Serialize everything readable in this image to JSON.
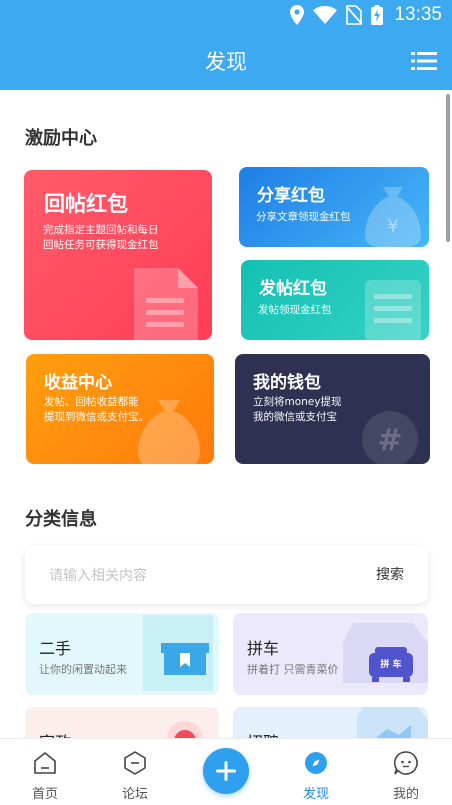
{
  "status_bar": {
    "time": "13:35",
    "icons": [
      "location-icon",
      "wifi-icon",
      "no-sim-icon",
      "battery-charging-icon"
    ]
  },
  "app_bar": {
    "title": "发现",
    "menu_icon": "list-menu-icon"
  },
  "incentive": {
    "section_title": "激励中心",
    "cards": {
      "reply": {
        "title": "回帖红包",
        "desc_line1": "完成指定主题回帖和每日",
        "desc_line2": "回帖任务可获得现金红包",
        "icon": "document-icon"
      },
      "share": {
        "title": "分享红包",
        "desc": "分享文章领现金红包",
        "icon": "money-bag-yuan-icon"
      },
      "post": {
        "title": "发帖红包",
        "desc": "发帖领现金红包",
        "icon": "document-icon"
      },
      "income": {
        "title": "收益中心",
        "desc_line1": "发帖、回帖收益都能",
        "desc_line2": "提现到微信或支付宝。",
        "icon": "money-bag-icon"
      },
      "wallet": {
        "title": "我的钱包",
        "desc_line1": "立刻将money提现",
        "desc_line2": "我的微信或支付宝",
        "icon": "hashtag-bubble-icon"
      }
    }
  },
  "category": {
    "section_title": "分类信息",
    "search": {
      "placeholder": "请输入相关内容",
      "button_label": "搜索"
    },
    "items": [
      {
        "title": "二手",
        "desc": "让你的闲置动起来",
        "icon": "box-icon"
      },
      {
        "title": "拼车",
        "desc": "拼着打 只需青菜价",
        "badge": "拼 车",
        "icon": "car-icon"
      },
      {
        "title": "家政",
        "icon": "heart-icon"
      },
      {
        "title": "招聘",
        "icon": "briefcase-icon"
      }
    ]
  },
  "bottom_nav": {
    "items": [
      {
        "label": "首页",
        "icon": "home-icon"
      },
      {
        "label": "论坛",
        "icon": "forum-icon"
      },
      {
        "label": "",
        "icon": "plus-icon"
      },
      {
        "label": "发现",
        "icon": "discover-icon",
        "active": true
      },
      {
        "label": "我的",
        "icon": "profile-icon"
      }
    ]
  },
  "colors": {
    "primary": "#3da9f0",
    "reply_card": "#ff4d5f",
    "share_card": "#2b8fec",
    "post_card": "#1ec6b8",
    "income_card": "#ff8c0e",
    "wallet_card": "#2f3152",
    "nav_active": "#1e8ee6"
  }
}
